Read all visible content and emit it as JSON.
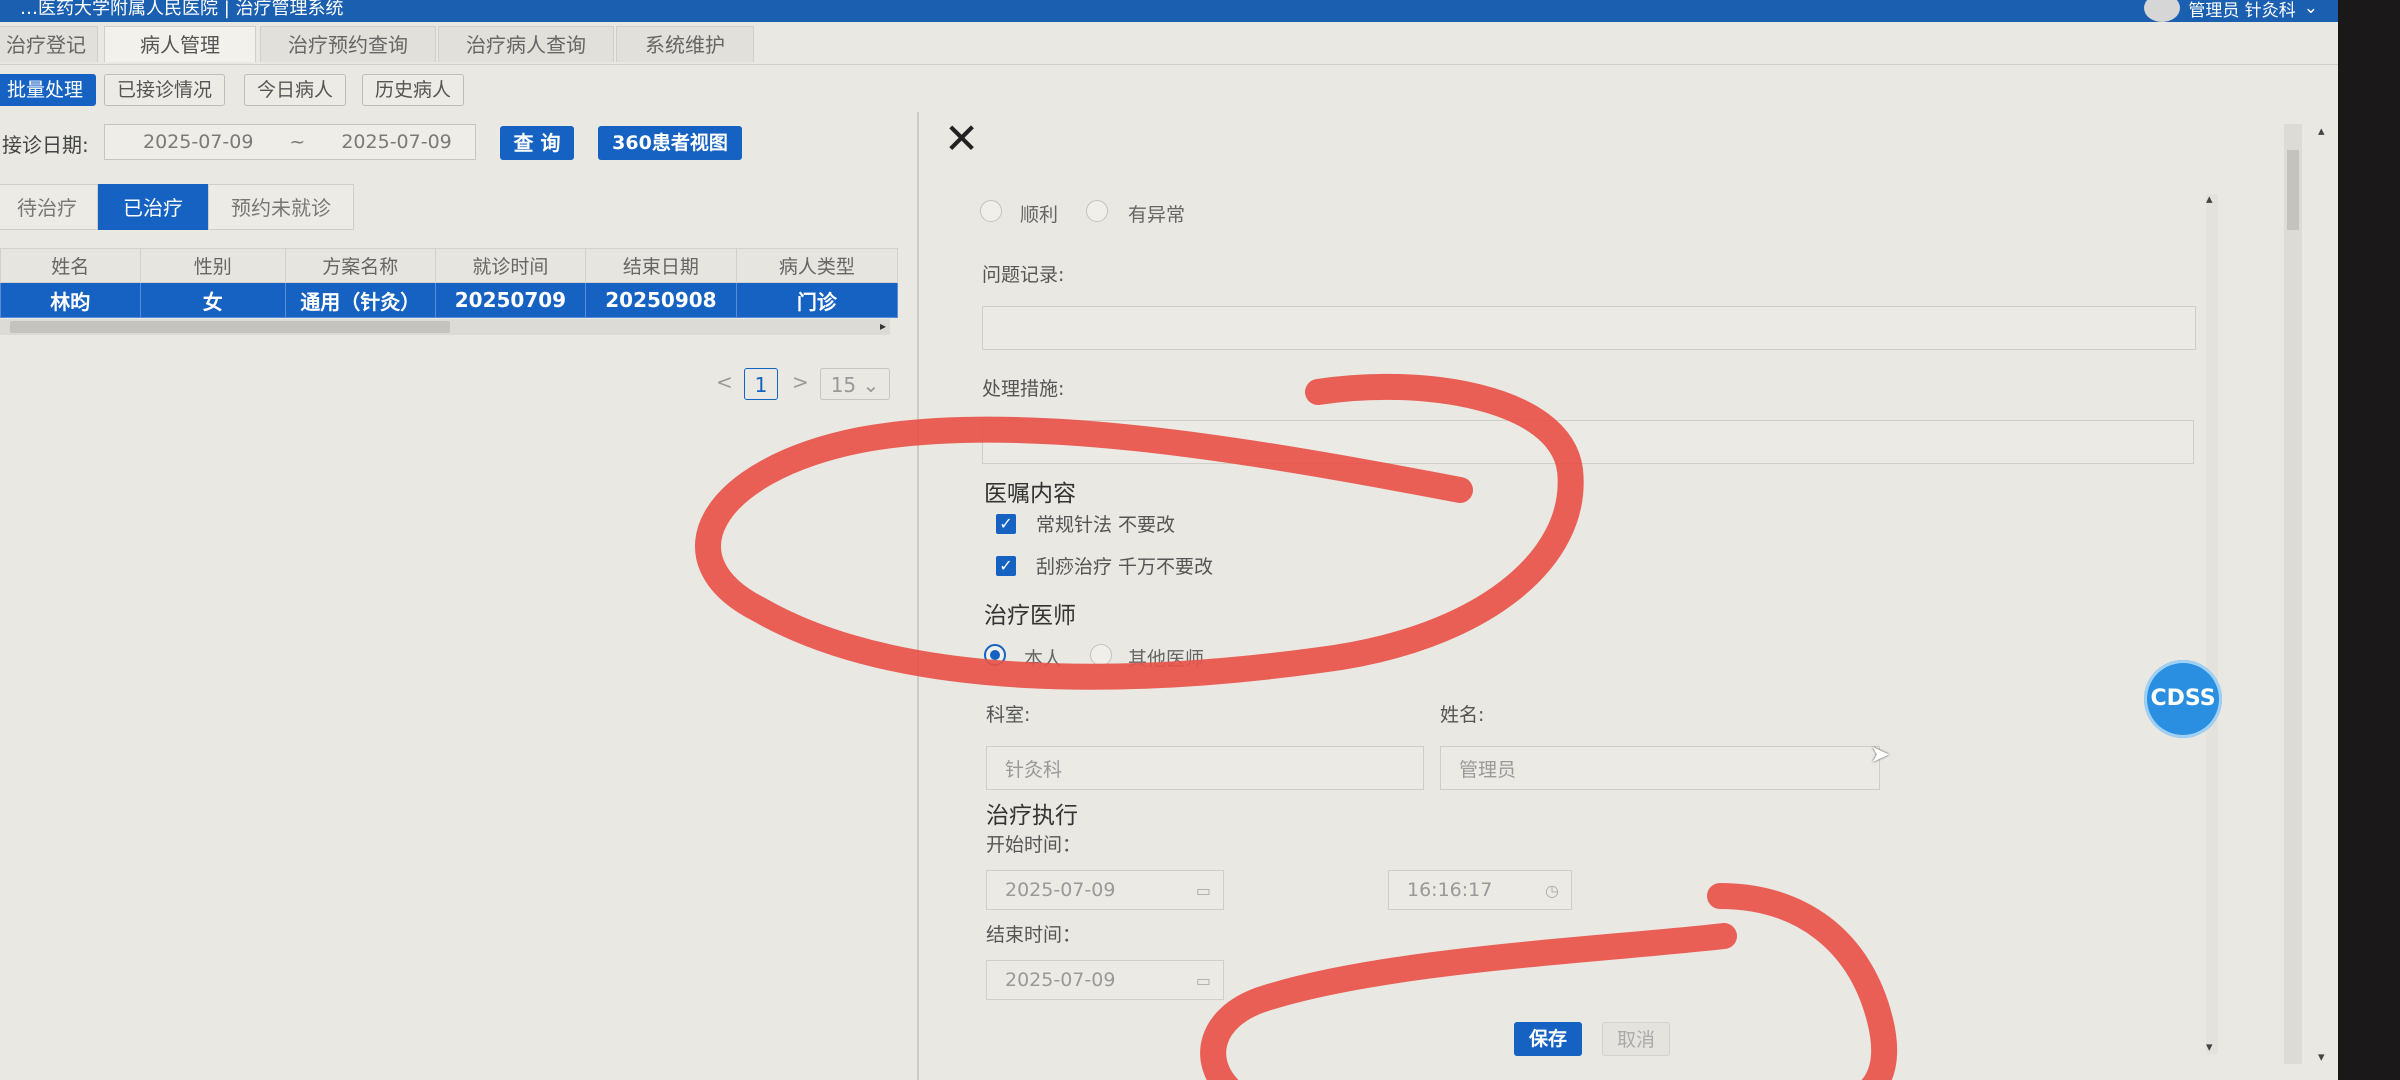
{
  "app": {
    "title": "…医药大学附属人民医院 | 治疗管理系统",
    "user": "管理员 针灸科"
  },
  "nav_tabs": [
    "治疗登记",
    "病人管理",
    "治疗预约查询",
    "治疗病人查询",
    "系统维护"
  ],
  "sub_toolbar": [
    "批量处理",
    "已接诊情况",
    "今日病人",
    "历史病人"
  ],
  "filter": {
    "date_label": "接诊日期:",
    "date_start": "2025-07-09",
    "date_sep": "~",
    "date_end": "2025-07-09",
    "query_button": "查 询",
    "view360_button": "360患者视图"
  },
  "status_tabs": [
    "待治疗",
    "已治疗",
    "预约未就诊"
  ],
  "table": {
    "headers": [
      "姓名",
      "性别",
      "方案名称",
      "就诊时间",
      "结束日期",
      "病人类型"
    ],
    "rows": [
      [
        "林昀",
        "女",
        "通用（针灸）",
        "20250709",
        "20250908",
        "门诊"
      ]
    ]
  },
  "pager": {
    "prev": "<",
    "current": "1",
    "next": ">",
    "page_size": "15"
  },
  "detail": {
    "close": "✕",
    "outcome_options": [
      "顺利",
      "有异常"
    ],
    "problem_label": "问题记录:",
    "measure_label": "处理措施:",
    "advice_title": "医嘱内容",
    "advice_items": [
      "常规针法 不要改",
      "刮痧治疗 千万不要改"
    ],
    "doctor_title": "治疗医师",
    "doctor_options": [
      "本人",
      "其他医师"
    ],
    "dept_label": "科室:",
    "name_label": "姓名:",
    "dept_value": "针灸科",
    "name_value": "管理员",
    "exec_title": "治疗执行",
    "start_label": "开始时间：",
    "start_date": "2025-07-09",
    "start_time": "16:16:17",
    "end_label": "结束时间：",
    "end_date": "2025-07-09",
    "save_button": "保存",
    "cancel_button": "取消"
  },
  "cdss": "CDSS",
  "colors": {
    "primary": "#1562c3",
    "annotation": "#e8524a",
    "background": "#e9e8e2"
  }
}
